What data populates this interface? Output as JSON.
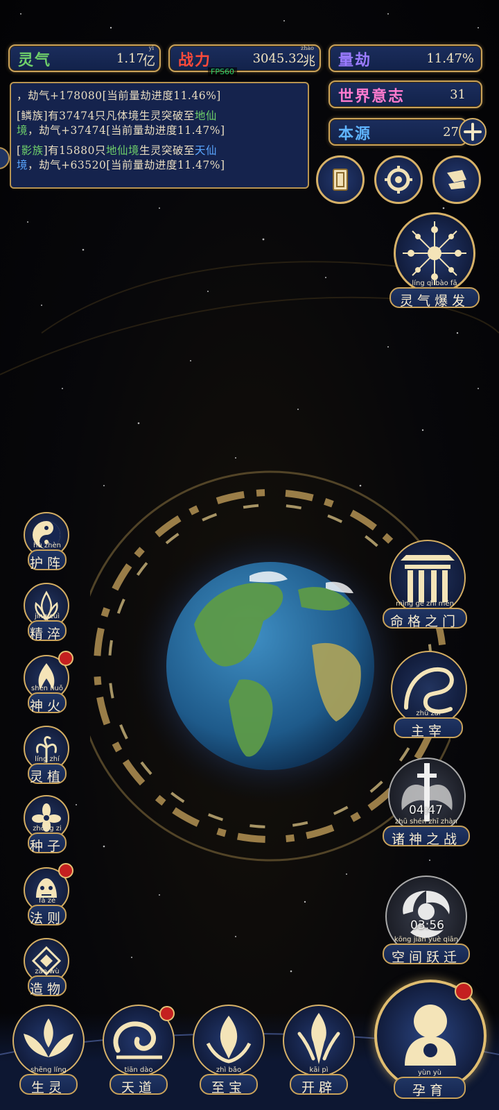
{
  "stats": {
    "lingqi": {
      "label": "灵气",
      "value": "1.17",
      "unit": "亿",
      "unit_ruby": "yì"
    },
    "zhanli": {
      "label": "战力",
      "value": "3045.32",
      "unit": "兆",
      "unit_ruby": "zhào"
    },
    "liangjie": {
      "label": "量劫",
      "value": "11.47%"
    },
    "shijie": {
      "label": "世界意志",
      "value": "31"
    },
    "benyuan": {
      "label": "本源",
      "value": "27"
    }
  },
  "fps": "FPS60",
  "log": [
    {
      "segments": [
        {
          "t": "，劫气+178080[当前量劫进度11.46%]",
          "c": ""
        }
      ]
    },
    {
      "segments": [
        {
          "t": "[鳞族]有37474只凡体境生灵突破至",
          "c": ""
        },
        {
          "t": "地仙",
          "c": "g"
        }
      ]
    },
    {
      "segments": [
        {
          "t": "境",
          "c": "g"
        },
        {
          "t": "，劫气+37474[当前量劫进度11.47%]",
          "c": ""
        }
      ]
    },
    {
      "segments": [
        {
          "t": "[",
          "c": ""
        },
        {
          "t": "影族",
          "c": "g"
        },
        {
          "t": "]有15880只",
          "c": ""
        },
        {
          "t": "地仙境",
          "c": "g"
        },
        {
          "t": "生灵突破至",
          "c": ""
        },
        {
          "t": "天仙",
          "c": "b"
        }
      ]
    },
    {
      "segments": [
        {
          "t": "境",
          "c": "b"
        },
        {
          "t": "，劫气+63520[当前量劫进度11.47%]",
          "c": ""
        }
      ]
    }
  ],
  "colors": {
    "gold": "#d6b168",
    "panel": "#1b2d5c",
    "red": "#c42020",
    "green": "#6fd06a",
    "blue": "#5aa6ff"
  },
  "burst": {
    "label": "灵气爆发",
    "ruby": "líng qì bào fā"
  },
  "left_buttons": [
    {
      "label": "护阵",
      "ruby": "hù zhèn",
      "icon": "yin-yang-icon",
      "badge": false
    },
    {
      "label": "精淬",
      "ruby": "jīng cuì",
      "icon": "lotus-flame-icon",
      "badge": false
    },
    {
      "label": "神火",
      "ruby": "shén huǒ",
      "icon": "divine-fire-icon",
      "badge": true
    },
    {
      "label": "灵植",
      "ruby": "líng zhí",
      "icon": "spirit-plant-icon",
      "badge": false
    },
    {
      "label": "种子",
      "ruby": "zhǒng zi",
      "icon": "seed-flower-icon",
      "badge": false
    },
    {
      "label": "法则",
      "ruby": "fǎ zé",
      "icon": "law-beast-icon",
      "badge": true
    },
    {
      "label": "造物",
      "ruby": "zào wù",
      "icon": "creation-rune-icon",
      "badge": false
    }
  ],
  "right_buttons": [
    {
      "label": "命格之门",
      "ruby": "mìng gé zhī mén",
      "icon": "gate-icon",
      "timer": ""
    },
    {
      "label": "主宰",
      "ruby": "zhǔ zǎi",
      "icon": "dragon-icon",
      "timer": ""
    },
    {
      "label": "诸神之战",
      "ruby": "zhū shén zhī zhàn",
      "icon": "sword-wings-icon",
      "timer": "04:47"
    },
    {
      "label": "空间跃迁",
      "ruby": "kōng jiān yuè qiān",
      "icon": "vortex-icon",
      "timer": "03:56"
    }
  ],
  "bottom_buttons": [
    {
      "label": "生灵",
      "ruby": "shēng líng",
      "icon": "phoenix-icon",
      "badge": false
    },
    {
      "label": "天道",
      "ruby": "tiān dào",
      "icon": "cloud-swirl-icon",
      "badge": true
    },
    {
      "label": "至宝",
      "ruby": "zhì bǎo",
      "icon": "treasure-icon",
      "badge": false
    },
    {
      "label": "开辟",
      "ruby": "kāi pì",
      "icon": "axe-flame-icon",
      "badge": false
    }
  ],
  "main_button": {
    "label": "孕育",
    "ruby": "yùn yù",
    "icon": "nurture-figure-icon",
    "badge": true
  }
}
